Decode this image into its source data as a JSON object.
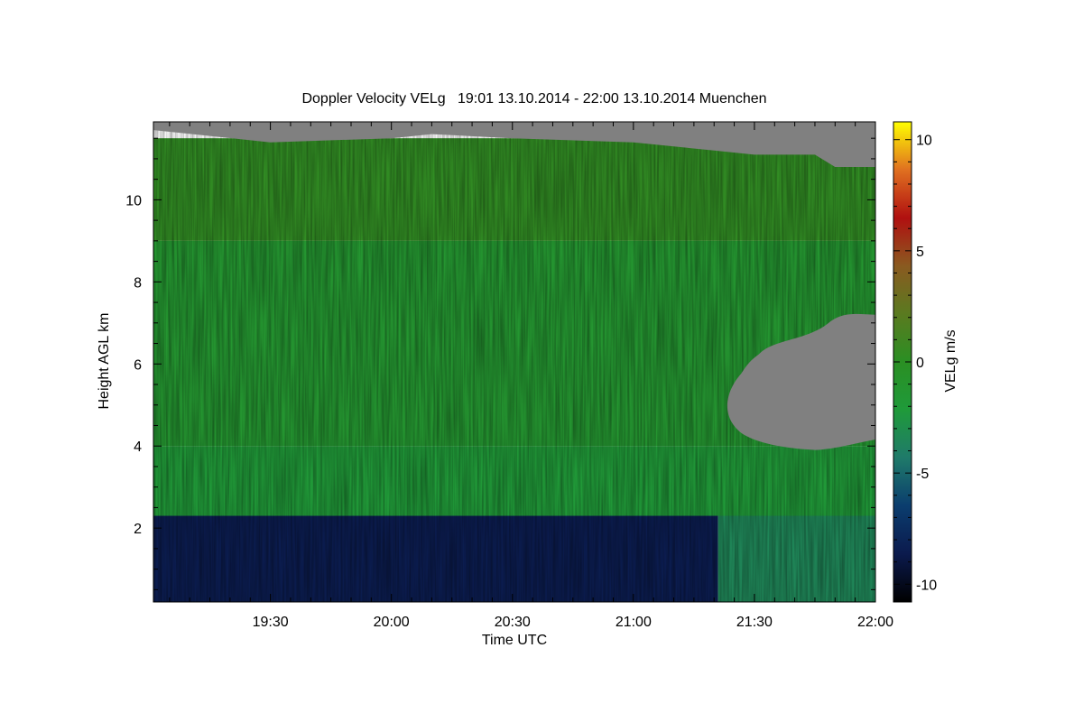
{
  "chart_data": {
    "type": "heatmap",
    "title": "Doppler Velocity VELg   19:01 13.10.2014 - 22:00 13.10.2014 Muenchen",
    "xlabel": "Time UTC",
    "ylabel": "Height AGL km",
    "colorbar_label": "VELg m/s",
    "x_range": [
      "19:01",
      "22:00"
    ],
    "x_ticks": [
      "19:30",
      "20:00",
      "20:30",
      "21:00",
      "21:30",
      "22:00"
    ],
    "y_range": [
      0.2,
      11.9
    ],
    "y_ticks": [
      2,
      4,
      6,
      8,
      10
    ],
    "color_range": [
      -10.8,
      10.8
    ],
    "color_ticks": [
      -10,
      -5,
      0,
      5,
      10
    ],
    "colormap": [
      "#000000",
      "#0b1a4d",
      "#0b3d6e",
      "#1f7a6a",
      "#1f9a3a",
      "#2a8f23",
      "#5a7a20",
      "#8a5a20",
      "#b01010",
      "#e07020",
      "#ffff00"
    ],
    "no_data_color": "#808080",
    "regions": [
      {
        "time_start": "19:01",
        "time_end": "21:21",
        "height_bottom": 0.2,
        "height_top": 2.3,
        "velocity": -8.5
      },
      {
        "time_start": "21:21",
        "time_end": "22:00",
        "height_bottom": 0.2,
        "height_top": 2.5,
        "velocity": -3.5
      },
      {
        "time_start": "19:01",
        "time_end": "22:00",
        "height_bottom": 2.3,
        "height_top": 4.0,
        "velocity": -2.0
      },
      {
        "time_start": "19:01",
        "time_end": "22:00",
        "height_bottom": 4.0,
        "height_top": 9.0,
        "velocity": -1.2
      },
      {
        "time_start": "19:01",
        "time_end": "22:00",
        "height_bottom": 9.0,
        "height_top": 11.5,
        "velocity": 0.3
      }
    ],
    "cloud_top_height_km": [
      [
        "19:01",
        11.7
      ],
      [
        "19:30",
        11.4
      ],
      [
        "20:00",
        11.5
      ],
      [
        "20:10",
        11.6
      ],
      [
        "20:30",
        11.5
      ],
      [
        "21:00",
        11.4
      ],
      [
        "21:20",
        11.2
      ],
      [
        "21:30",
        11.1
      ],
      [
        "21:45",
        11.1
      ],
      [
        "21:50",
        10.8
      ],
      [
        "22:00",
        10.8
      ]
    ],
    "no_signal_gap": {
      "time_start": "21:23",
      "time_end": "22:00",
      "height_bottom_km": 4.0,
      "height_top_km": 7.2
    }
  }
}
